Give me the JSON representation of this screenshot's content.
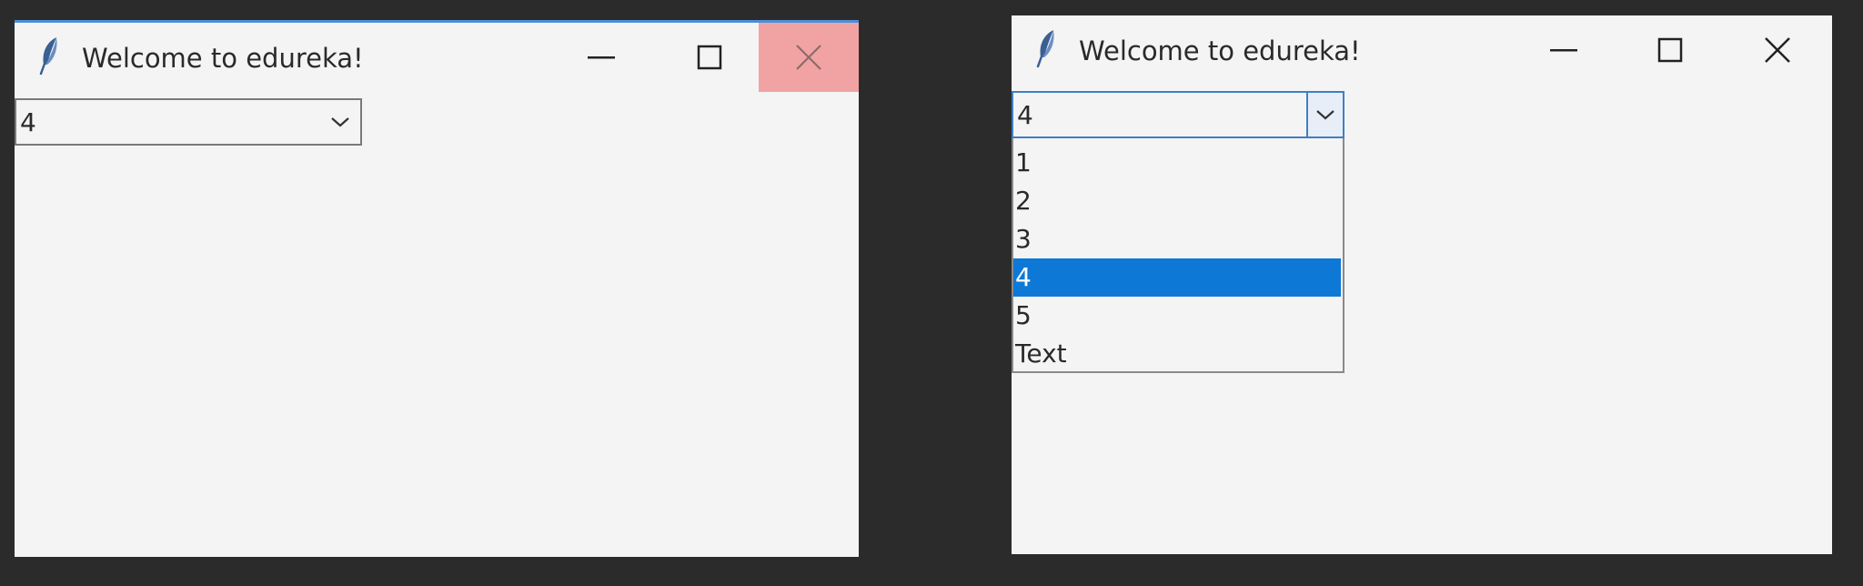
{
  "windows": [
    {
      "title": "Welcome to edureka!",
      "combobox": {
        "value": "4"
      }
    },
    {
      "title": "Welcome to edureka!",
      "combobox": {
        "value": "4"
      },
      "dropdown": {
        "options": [
          "1",
          "2",
          "3",
          "4",
          "5",
          "Text"
        ],
        "selected": "4"
      }
    }
  ],
  "icons": {
    "app": "feather-icon",
    "minimize": "minimize-icon",
    "maximize": "maximize-icon",
    "close": "close-icon",
    "dropdown": "chevron-down-icon"
  },
  "colors": {
    "desktop": "#2b2b2b",
    "window": "#f4f4f4",
    "close_hover": "#f1a3a3",
    "selection": "#0e78d7",
    "focus_border": "#3f7fc4"
  }
}
